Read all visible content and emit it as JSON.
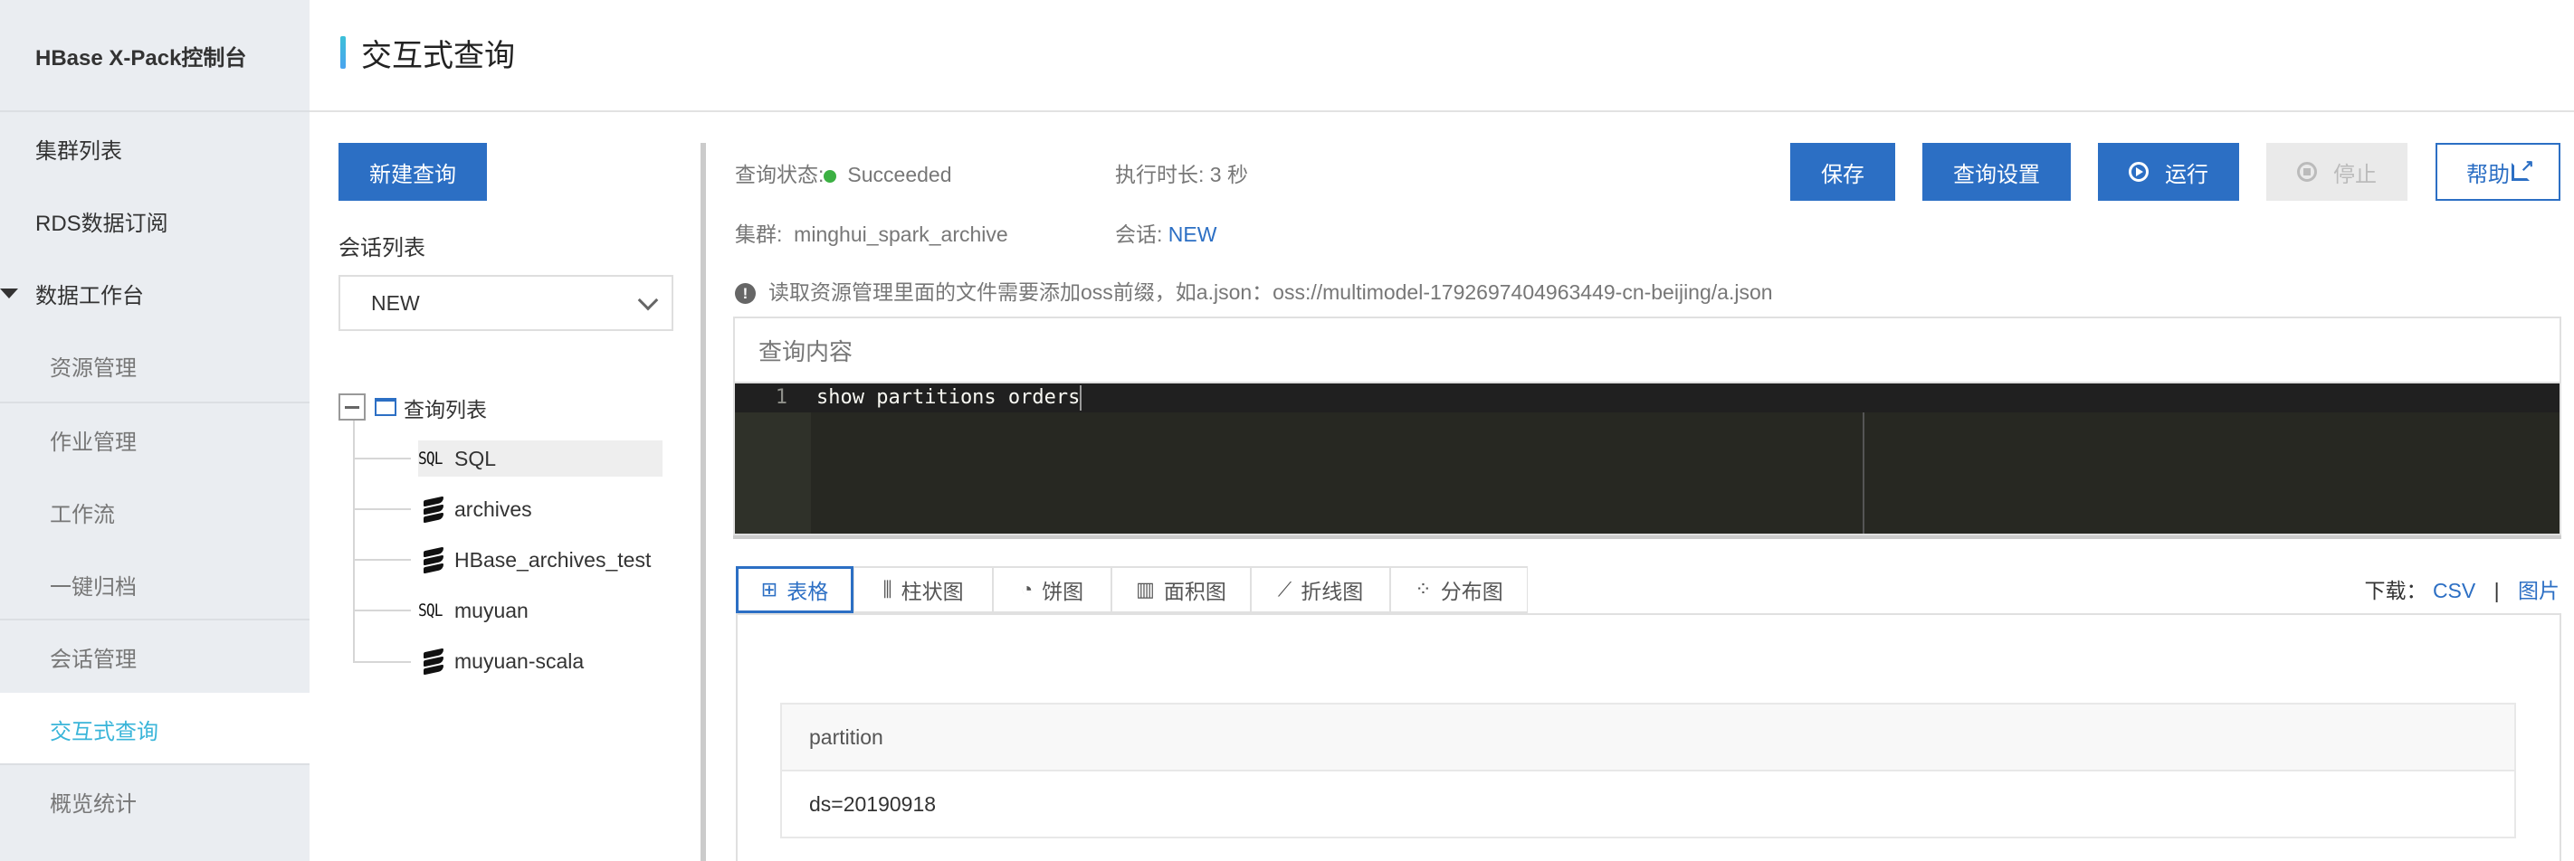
{
  "sidebar": {
    "brand": "HBase X-Pack控制台",
    "items": [
      {
        "label": "集群列表"
      },
      {
        "label": "RDS数据订阅"
      },
      {
        "label": "数据工作台"
      },
      {
        "label": "资源管理"
      },
      {
        "label": "作业管理"
      },
      {
        "label": "工作流"
      },
      {
        "label": "一键归档"
      },
      {
        "label": "会话管理"
      },
      {
        "label": "交互式查询"
      },
      {
        "label": "概览统计"
      }
    ],
    "active": "交互式查询"
  },
  "header": {
    "title": "交互式查询"
  },
  "left_panel": {
    "new_query_label": "新建查询",
    "session_list_label": "会话列表",
    "session_select_value": "NEW",
    "tree": {
      "root_label": "查询列表",
      "items": [
        {
          "icon": "sql-icon",
          "icon_text": "SQL",
          "label": "SQL",
          "selected": true
        },
        {
          "icon": "scala-icon",
          "label": "archives"
        },
        {
          "icon": "scala-icon",
          "label": "HBase_archives_test"
        },
        {
          "icon": "sql-icon",
          "icon_text": "SQL",
          "label": "muyuan"
        },
        {
          "icon": "scala-icon",
          "label": "muyuan-scala"
        }
      ]
    }
  },
  "info": {
    "status_label": "查询状态:",
    "status_value": "Succeeded",
    "status_color": "#3cb043",
    "duration_label": "执行时长:",
    "duration_value": "3 秒",
    "cluster_label": "集群:",
    "cluster_value": "minghui_spark_archive",
    "session_label": "会话:",
    "session_value": "NEW",
    "notice": "读取资源管理里面的文件需要添加oss前缀，如a.json：oss://multimodel-1792697404963449-cn-beijing/a.json"
  },
  "toolbar": {
    "save_label": "保存",
    "settings_label": "查询设置",
    "run_label": "运行",
    "stop_label": "停止",
    "help_label": "帮助"
  },
  "editor": {
    "title": "查询内容",
    "lines": [
      {
        "no": "1",
        "code": "show partitions orders"
      }
    ]
  },
  "result": {
    "tabs": [
      {
        "label": "表格",
        "icon": "table-icon",
        "glyph": "⊞"
      },
      {
        "label": "柱状图",
        "icon": "bar-chart-icon",
        "glyph": "📊"
      },
      {
        "label": "饼图",
        "icon": "pie-chart-icon",
        "glyph": "◔"
      },
      {
        "label": "面积图",
        "icon": "area-chart-icon",
        "glyph": "▥"
      },
      {
        "label": "折线图",
        "icon": "line-chart-icon",
        "glyph": "⟋"
      },
      {
        "label": "分布图",
        "icon": "scatter-chart-icon",
        "glyph": "⁘"
      }
    ],
    "active_tab": "表格",
    "download_label": "下载：",
    "download_csv": "CSV",
    "download_sep": "|",
    "download_image": "图片",
    "table": {
      "columns": [
        "partition"
      ],
      "rows": [
        [
          "ds=20190918"
        ]
      ]
    }
  },
  "colors": {
    "accent": "#2c6fc4",
    "active_nav": "#3ab5d9",
    "editor_bg": "#272822"
  }
}
